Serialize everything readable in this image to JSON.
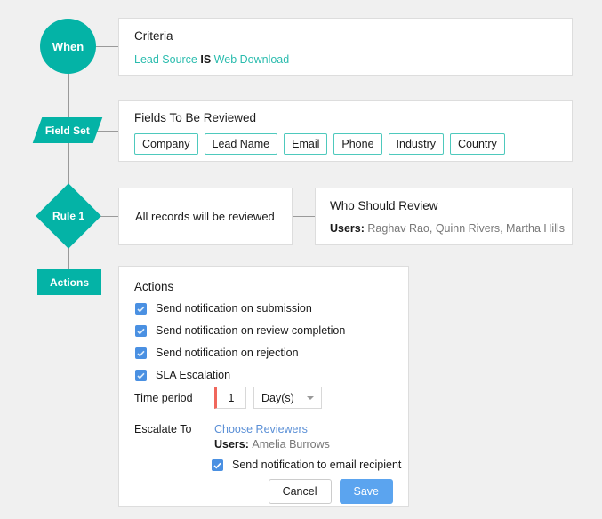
{
  "theme": {
    "accent_teal": "#04b3a6",
    "chip_border": "#4ec9bd",
    "link_blue": "#5a8fd6",
    "checkbox_blue": "#4a90e2",
    "save_blue": "#5ba4ef",
    "required_red": "#f0675c",
    "page_bg": "#f0f0f0"
  },
  "flow": {
    "when_label": "When",
    "field_set_label": "Field Set",
    "rule_label": "Rule 1",
    "actions_label": "Actions"
  },
  "criteria": {
    "title": "Criteria",
    "field": "Lead Source",
    "operator": "IS",
    "value": "Web Download"
  },
  "fields_to_be_reviewed": {
    "title": "Fields To Be Reviewed",
    "chips": [
      "Company",
      "Lead Name",
      "Email",
      "Phone",
      "Industry",
      "Country"
    ]
  },
  "rule": {
    "summary": "All records will be reviewed"
  },
  "who_should_review": {
    "title": "Who Should Review",
    "users_label": "Users",
    "users_separator": ": ",
    "users_value": "Raghav Rao, Quinn Rivers, Martha Hills"
  },
  "actions": {
    "title": "Actions",
    "checkboxes": [
      {
        "label": "Send notification on submission",
        "checked": true
      },
      {
        "label": "Send notification on review completion",
        "checked": true
      },
      {
        "label": "Send notification on rejection",
        "checked": true
      },
      {
        "label": "SLA Escalation",
        "checked": true
      }
    ],
    "time_period": {
      "label": "Time period",
      "value": "1",
      "unit": "Day(s)"
    },
    "escalate_to": {
      "label": "Escalate To",
      "link": "Choose Reviewers",
      "users_label": "Users",
      "users_separator": ": ",
      "users_value": "Amelia Burrows"
    },
    "email_recipient": {
      "label": "Send notification to email recipient",
      "checked": true
    },
    "buttons": {
      "cancel": "Cancel",
      "save": "Save"
    }
  }
}
